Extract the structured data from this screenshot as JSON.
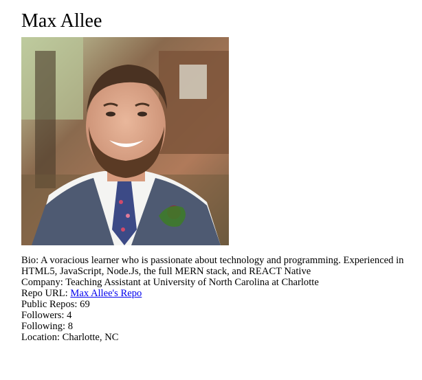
{
  "profile": {
    "name": "Max Allee",
    "bio_label": "Bio:",
    "bio": "A voracious learner who is passionate about technology and programming. Experienced in HTML5, JavaScript, Node.Js, the full MERN stack, and REACT Native",
    "company_label": "Company:",
    "company": "Teaching Assistant at University of North Carolina at Charlotte",
    "repo_label": "Repo URL:",
    "repo_link_text": "Max Allee's Repo",
    "public_repos_label": "Public Repos:",
    "public_repos": "69",
    "followers_label": "Followers:",
    "followers": "4",
    "following_label": "Following:",
    "following": "8",
    "location_label": "Location:",
    "location": "Charlotte, NC"
  },
  "colors": {
    "link": "#0000ee",
    "text": "#000000",
    "background": "#ffffff"
  }
}
